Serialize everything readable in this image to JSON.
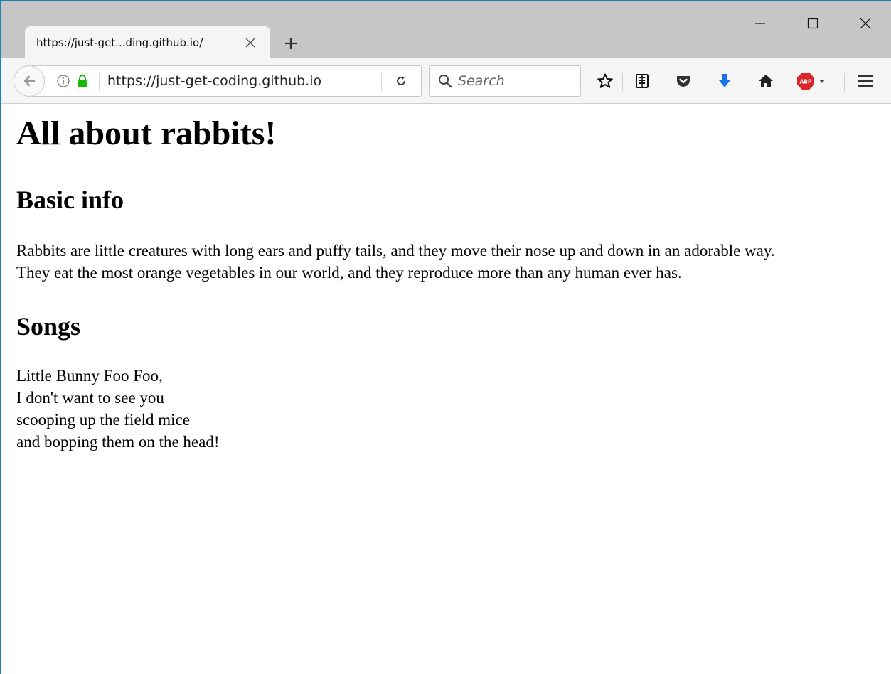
{
  "browser": {
    "tab": {
      "title": "https://just-get...ding.github.io/"
    },
    "url": "https://just-get-coding.github.io",
    "search": {
      "placeholder": "Search"
    }
  },
  "page": {
    "heading": "All about rabbits!",
    "sections": [
      {
        "heading": "Basic info",
        "paragraph_lines": [
          "Rabbits are little creatures with long ears and puffy tails, and they move their nose up and down in an adorable way.",
          "They eat the most orange vegetables in our world, and they reproduce more than any human ever has."
        ]
      },
      {
        "heading": "Songs",
        "paragraph_lines": [
          "Little Bunny Foo Foo,",
          "I don't want to see you",
          "scooping up the field mice",
          "and bopping them on the head!"
        ]
      }
    ]
  },
  "colors": {
    "download_arrow": "#1a73e8",
    "lock_green": "#12bc00",
    "abp_red": "#d8262b"
  },
  "icons": {
    "back": "back-arrow-icon",
    "info": "info-icon",
    "lock": "lock-icon",
    "reload": "reload-icon",
    "search": "search-icon",
    "bookmark": "star-icon",
    "reader": "reader-view-icon",
    "pocket": "pocket-icon",
    "downloads": "download-icon",
    "home": "home-icon",
    "adblock": "adblock-plus-icon",
    "menu": "hamburger-menu-icon"
  }
}
